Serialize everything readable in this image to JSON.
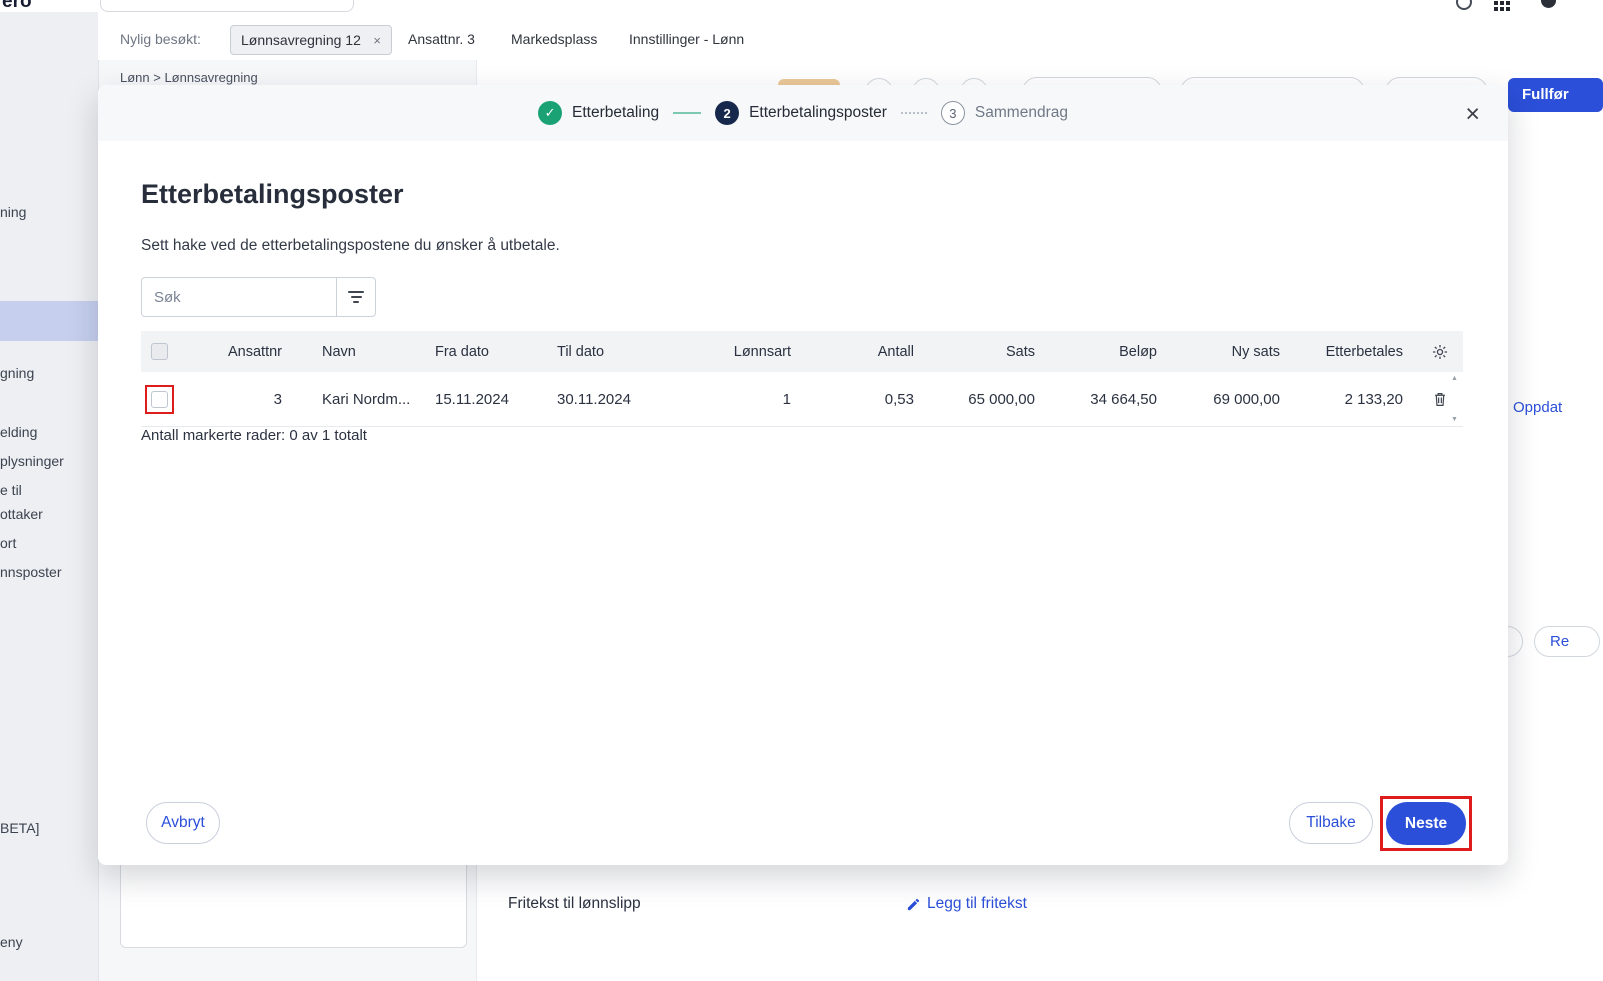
{
  "icons": {
    "check": "✓",
    "close": "×",
    "scroll_up": "▲",
    "scroll_down": "▼"
  },
  "topbar": {
    "logo_fragment": "ero",
    "recent_label": "Nylig besøkt:",
    "tabs": [
      {
        "label": "Lønnsavregning 12"
      },
      {
        "label": "Ansattnr. 3"
      },
      {
        "label": "Markedsplass"
      },
      {
        "label": "Innstillinger - Lønn"
      }
    ],
    "breadcrumb": "Lønn > Lønnsavregning",
    "fullfor_label": "Fullfør"
  },
  "sidebar": {
    "fragments": [
      "ning",
      "gning",
      "elding",
      "plysninger",
      "e til",
      "ottaker",
      "ort",
      "nnsposter",
      "BETA]",
      "eny"
    ]
  },
  "background": {
    "oppdat_fragment": "Oppdat",
    "re_fragment": "Re",
    "fritekst_label": "Fritekst til lønnslipp",
    "fritekst_link": "Legg til fritekst"
  },
  "modal": {
    "stepper": [
      {
        "label": "Etterbetaling",
        "state": "done"
      },
      {
        "number": "2",
        "label": "Etterbetalingsposter",
        "state": "active"
      },
      {
        "number": "3",
        "label": "Sammendrag",
        "state": "upcoming"
      }
    ],
    "title": "Etterbetalingsposter",
    "subtitle": "Sett hake ved de etterbetalingspostene du ønsker å utbetale.",
    "search_placeholder": "Søk",
    "table": {
      "columns": [
        "Ansattnr",
        "Navn",
        "Fra dato",
        "Til dato",
        "Lønnsart",
        "Antall",
        "Sats",
        "Beløp",
        "Ny sats",
        "Etterbetales"
      ],
      "row": {
        "cells": [
          "3",
          "Kari Nordm...",
          "15.11.2024",
          "30.11.2024",
          "1",
          "0,53",
          "65 000,00",
          "34 664,50",
          "69 000,00",
          "2 133,20"
        ]
      },
      "summary": "Antall markerte rader: 0 av 1 totalt"
    },
    "buttons": {
      "cancel": "Avbryt",
      "back": "Tilbake",
      "next": "Neste"
    }
  },
  "colors": {
    "primary": "#2b4fd8",
    "step_done": "#1aa274",
    "step_active": "#17284d",
    "annotation": "#df1c1c"
  }
}
